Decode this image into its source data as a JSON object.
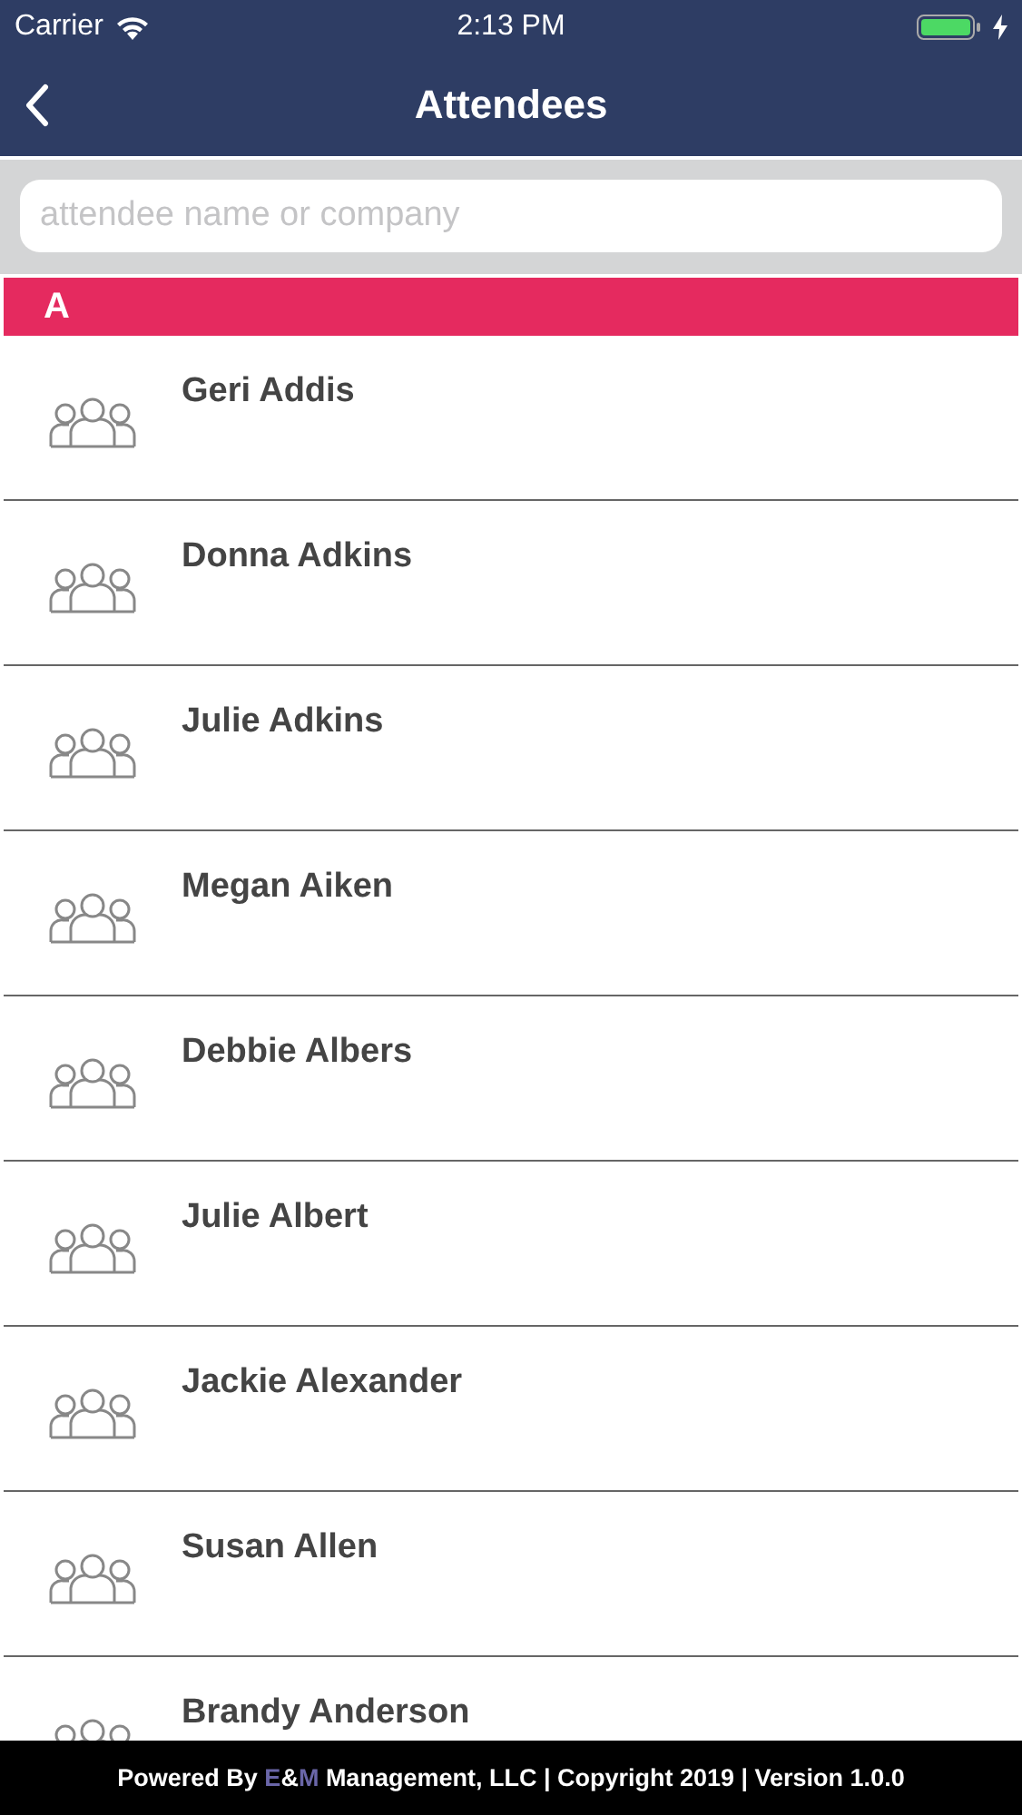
{
  "status_bar": {
    "carrier": "Carrier",
    "time": "2:13 PM",
    "battery_charging": true
  },
  "nav": {
    "title": "Attendees"
  },
  "search": {
    "placeholder": "attendee name or company"
  },
  "sections": [
    {
      "letter": "A",
      "rows": [
        {
          "name": "Geri Addis"
        },
        {
          "name": "Donna Adkins"
        },
        {
          "name": "Julie Adkins"
        },
        {
          "name": "Megan Aiken"
        },
        {
          "name": "Debbie Albers"
        },
        {
          "name": "Julie Albert"
        },
        {
          "name": "Jackie Alexander"
        },
        {
          "name": "Susan Allen"
        },
        {
          "name": "Brandy Anderson"
        }
      ]
    }
  ],
  "footer": {
    "segments": [
      {
        "text": "Powered By ",
        "accent": false
      },
      {
        "text": "E",
        "accent": true
      },
      {
        "text": "&",
        "accent": false
      },
      {
        "text": "M",
        "accent": true
      },
      {
        "text": " Management, LLC | Copyright 2019 | Version 1.0.0",
        "accent": false
      }
    ]
  }
}
